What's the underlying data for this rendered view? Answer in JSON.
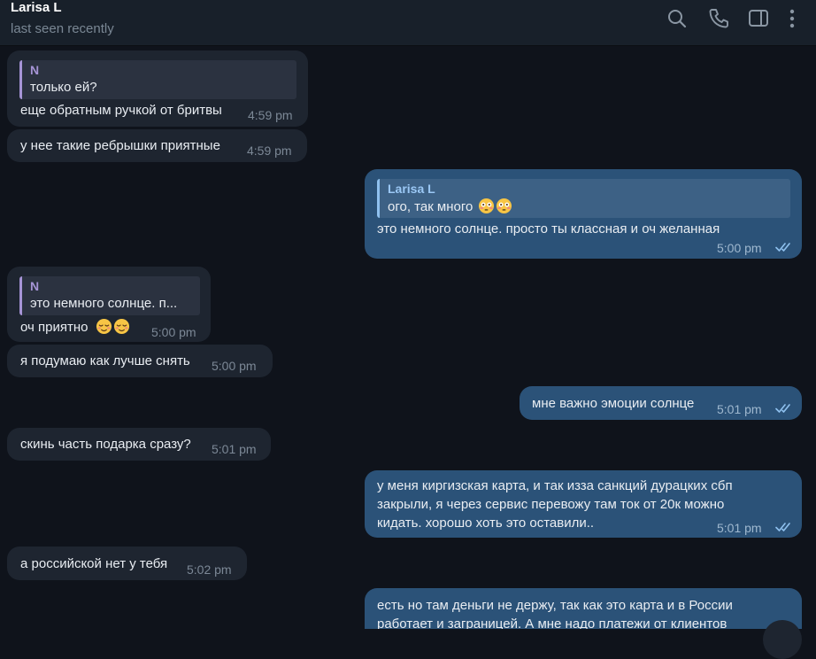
{
  "header": {
    "name": "Larisa L",
    "status": "last seen recently",
    "icons": [
      "search-icon",
      "phone-icon",
      "sidebar-toggle-icon",
      "more-vertical-icon"
    ]
  },
  "colors": {
    "background": "#0f131b",
    "incoming_bubble": "#1e2530",
    "outgoing_bubble": "#2b5278",
    "reply_accent_in": "#a694d6",
    "reply_accent_out": "#8fc1ef",
    "read_check": "#8fc1ef"
  },
  "messages": [
    {
      "dir": "in",
      "reply_name": "N",
      "reply_text": "только ей?",
      "text": "еще обратным ручкой от бритвы",
      "time": "4:59 pm"
    },
    {
      "dir": "in",
      "text": "у нее такие ребрышки приятные",
      "time": "4:59 pm"
    },
    {
      "dir": "out",
      "reply_name": "Larisa L",
      "reply_text": "ого, так много",
      "reply_emoji": [
        "flushed-face-emoji",
        "flushed-face-emoji"
      ],
      "text": "это немного солнце. просто ты классная и оч желанная",
      "time": "5:00 pm",
      "read": true
    },
    {
      "dir": "in",
      "reply_name": "N",
      "reply_text": "это немного солнце. п...",
      "text": "оч приятно",
      "emoji": [
        "relieved-face-emoji",
        "relieved-face-emoji"
      ],
      "time": "5:00 pm"
    },
    {
      "dir": "in",
      "text": "я подумаю как лучше снять",
      "time": "5:00 pm"
    },
    {
      "dir": "out",
      "text": "мне важно эмоции солнце",
      "time": "5:01 pm",
      "read": true
    },
    {
      "dir": "in",
      "text": "скинь часть подарка сразу?",
      "time": "5:01 pm"
    },
    {
      "dir": "out",
      "lines": [
        "у меня киргизская карта, и так изза санкций дурацких сбп",
        "закрыли, я через сервис перевожу там ток от 20к можно",
        "кидать. хорошо хоть это оставили.."
      ],
      "time": "5:01 pm",
      "read": true
    },
    {
      "dir": "in",
      "text": "а российской нет у тебя",
      "time": "5:02 pm"
    },
    {
      "dir": "out",
      "lines": [
        "есть но там деньги не держу, так как это карта и в России",
        "работает и заграницей. А мне надо платежи от клиентов"
      ]
    }
  ]
}
